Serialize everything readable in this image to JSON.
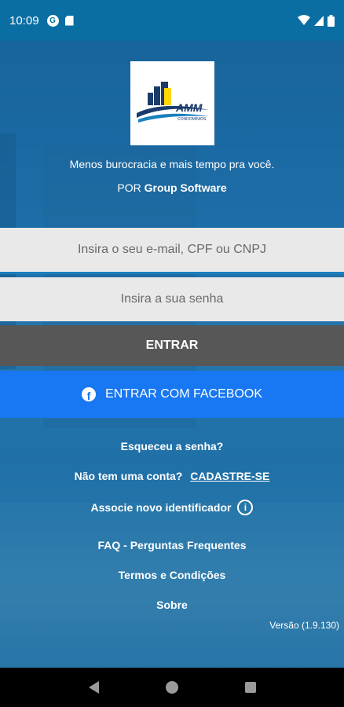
{
  "status_bar": {
    "time": "10:09",
    "icons": [
      "app-notification-icon",
      "sd-card-icon",
      "wifi-icon",
      "signal-icon",
      "battery-icon"
    ]
  },
  "logo": {
    "text": "AMM",
    "subtext": "CONDOMINIOS"
  },
  "tagline": "Menos burocracia e mais tempo pra você.",
  "byline": {
    "prefix": "POR",
    "company": "Group Software"
  },
  "login": {
    "email_placeholder": "Insira o seu e-mail, CPF ou CNPJ",
    "password_placeholder": "Insira a sua senha",
    "enter_label": "ENTRAR",
    "facebook_label": "ENTRAR COM FACEBOOK"
  },
  "links": {
    "forgot": "Esqueceu a senha?",
    "no_account": "Não tem uma conta?",
    "signup": "CADASTRE-SE",
    "associate": "Associe novo identificador",
    "faq": "FAQ - Perguntas Frequentes",
    "terms": "Termos e Condições",
    "about": "Sobre"
  },
  "version": "Versão (1.9.130)",
  "colors": {
    "status_bar": "#0b6ea3",
    "enter_button": "#575757",
    "facebook_button": "#1877f2",
    "input_background": "#e9e9e9",
    "input_focus_underline": "#1a7fbf"
  }
}
